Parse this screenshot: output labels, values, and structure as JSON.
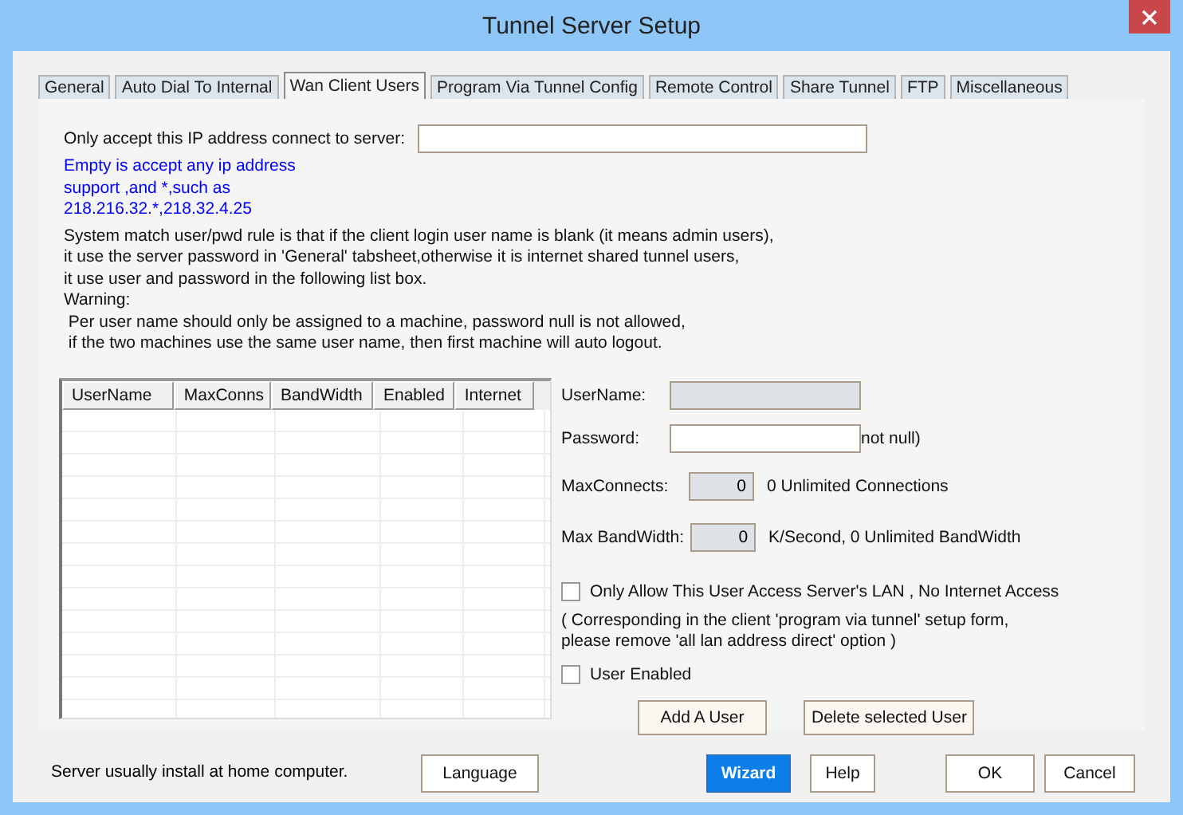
{
  "window": {
    "title": "Tunnel Server Setup"
  },
  "tabs": [
    {
      "label": "General",
      "selected": false
    },
    {
      "label": "Auto Dial To Internal",
      "selected": false
    },
    {
      "label": "Wan Client Users",
      "selected": true
    },
    {
      "label": "Program Via Tunnel Config",
      "selected": false
    },
    {
      "label": "Remote Control",
      "selected": false
    },
    {
      "label": "Share Tunnel",
      "selected": false
    },
    {
      "label": "FTP",
      "selected": false
    },
    {
      "label": "Miscellaneous",
      "selected": false
    }
  ],
  "ip_filter": {
    "label": "Only accept this IP address connect to server:"
  },
  "hint_text": "Empty is accept any ip address\nsupport ,and *,such as\n218.216.32.*,218.32.4.25",
  "rule_text": "System match user/pwd rule is that if the client login user name is blank (it means admin users),\nit use the server password in 'General' tabsheet,otherwise it is internet shared tunnel users,\nit use user and password in the following list box.",
  "warning_text": "Warning:\n Per user name should only be assigned to a machine, password null is not allowed,\n if the two machines use the same user name, then first machine will auto logout.",
  "user_table": {
    "columns": [
      "UserName",
      "MaxConns",
      "BandWidth",
      "Enabled",
      "Internet"
    ]
  },
  "fields": [
    {
      "kind": "text",
      "label": "UserName:",
      "readonly": true
    },
    {
      "kind": "text",
      "label": "Password:",
      "readonly": false,
      "suffix": "not null)"
    },
    {
      "kind": "number",
      "label": "MaxConnects:",
      "readonly": true,
      "value": "0",
      "note": "0 Unlimited Connections"
    },
    {
      "kind": "number",
      "label": "Max BandWidth:",
      "readonly": true,
      "value": "0",
      "note": "K/Second, 0 Unlimited BandWidth"
    }
  ],
  "lan_only": {
    "label": "Only Allow This User Access Server's LAN , No Internet Access",
    "checked": false
  },
  "lan_note": "( Corresponding in the client 'program via tunnel' setup form,\nplease remove 'all lan address direct' option )",
  "user_enabled": {
    "label": "User Enabled",
    "checked": false
  },
  "form_buttons": [
    "Add A User",
    "Delete selected User"
  ],
  "footer": {
    "note": "Server usually install at home computer.",
    "buttons": [
      {
        "label": "Language",
        "focused": false
      },
      {
        "label": "Wizard",
        "focused": true
      },
      {
        "label": "Help",
        "focused": false
      },
      {
        "label": "OK",
        "focused": false
      },
      {
        "label": "Cancel",
        "focused": false
      }
    ]
  }
}
